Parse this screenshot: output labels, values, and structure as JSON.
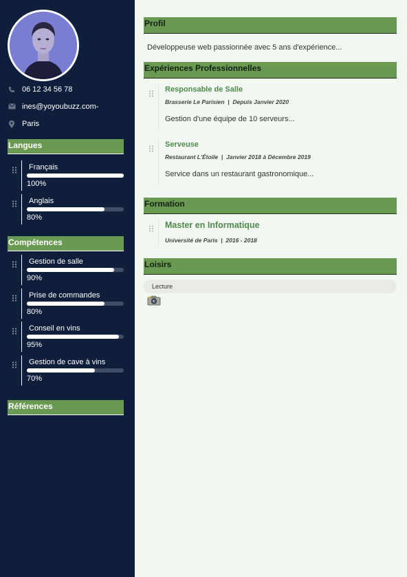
{
  "contact": {
    "phone": "06 12 34 56 78",
    "email": "ines@yoyoubuzz.com-",
    "city": "Paris"
  },
  "icons": {
    "phone": "phone-icon",
    "email": "envelope-icon",
    "location": "map-pin-icon",
    "grip": "drag-handle-icon",
    "camera": "camera-icon"
  },
  "colors": {
    "sidebar_bg": "#0f1f3b",
    "accent_green": "#6a9a52",
    "title_green": "#4e8a4c",
    "page_bg": "#f3f7f2"
  },
  "sidebar": {
    "languages_header": "Langues",
    "languages": [
      {
        "name": "Français",
        "percent_label": "100%",
        "level": 1.0
      },
      {
        "name": "Anglais",
        "percent_label": "80%",
        "level": 0.8
      }
    ],
    "skills_header": "Compétences",
    "skills": [
      {
        "name": "Gestion de salle",
        "percent_label": "90%",
        "level": 0.9
      },
      {
        "name": "Prise de commandes",
        "percent_label": "80%",
        "level": 0.8
      },
      {
        "name": "Conseil en vins",
        "percent_label": "95%",
        "level": 0.95
      },
      {
        "name": "Gestion de cave à vins",
        "percent_label": "70%",
        "level": 0.7
      }
    ],
    "references_header": "Références"
  },
  "main": {
    "profile_header": "Profil",
    "profile_text": "Développeuse web passionnée avec 5 ans d'expérience...",
    "experience_header": "Expériences Professionnelles",
    "experiences": [
      {
        "title": "Responsable de Salle",
        "company": "Brasserie Le Parisien",
        "sep": "|",
        "period": "Depuis Janvier 2020",
        "description": "Gestion d'une équipe de 10 serveurs..."
      },
      {
        "title": "Serveuse",
        "company": "Restaurant L'Étoile",
        "sep": "|",
        "period": "Janvier 2018 à Décembre 2019",
        "description": "Service dans un restaurant gastronomique..."
      }
    ],
    "education_header": "Formation",
    "education": [
      {
        "title": "Master en Informatique",
        "school": "Université de Paris",
        "sep": "|",
        "period": "2016 - 2018"
      }
    ],
    "hobbies_header": "Loisirs",
    "hobbies": [
      "Lecture"
    ]
  }
}
